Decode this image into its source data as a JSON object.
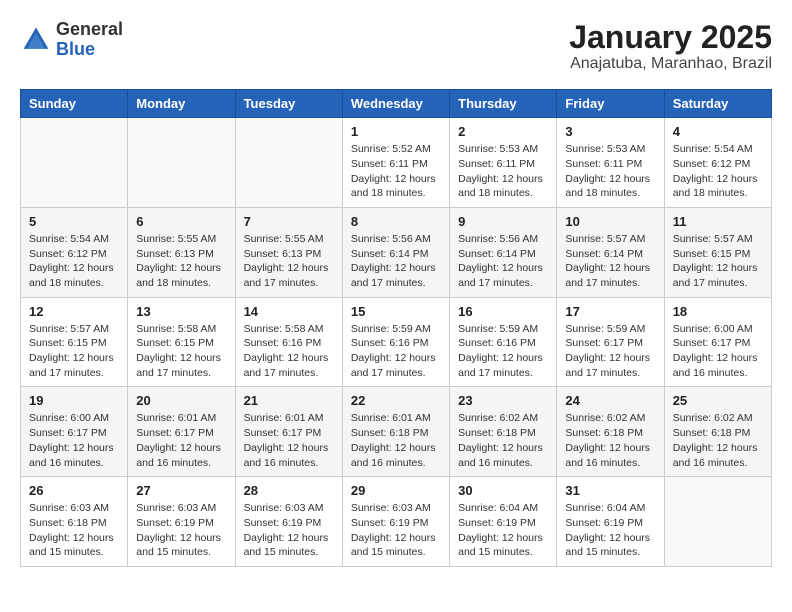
{
  "header": {
    "logo_general": "General",
    "logo_blue": "Blue",
    "title": "January 2025",
    "subtitle": "Anajatuba, Maranhao, Brazil"
  },
  "days_of_week": [
    "Sunday",
    "Monday",
    "Tuesday",
    "Wednesday",
    "Thursday",
    "Friday",
    "Saturday"
  ],
  "weeks": [
    [
      {
        "day": "",
        "info": ""
      },
      {
        "day": "",
        "info": ""
      },
      {
        "day": "",
        "info": ""
      },
      {
        "day": "1",
        "info": "Sunrise: 5:52 AM\nSunset: 6:11 PM\nDaylight: 12 hours\nand 18 minutes."
      },
      {
        "day": "2",
        "info": "Sunrise: 5:53 AM\nSunset: 6:11 PM\nDaylight: 12 hours\nand 18 minutes."
      },
      {
        "day": "3",
        "info": "Sunrise: 5:53 AM\nSunset: 6:11 PM\nDaylight: 12 hours\nand 18 minutes."
      },
      {
        "day": "4",
        "info": "Sunrise: 5:54 AM\nSunset: 6:12 PM\nDaylight: 12 hours\nand 18 minutes."
      }
    ],
    [
      {
        "day": "5",
        "info": "Sunrise: 5:54 AM\nSunset: 6:12 PM\nDaylight: 12 hours\nand 18 minutes."
      },
      {
        "day": "6",
        "info": "Sunrise: 5:55 AM\nSunset: 6:13 PM\nDaylight: 12 hours\nand 18 minutes."
      },
      {
        "day": "7",
        "info": "Sunrise: 5:55 AM\nSunset: 6:13 PM\nDaylight: 12 hours\nand 17 minutes."
      },
      {
        "day": "8",
        "info": "Sunrise: 5:56 AM\nSunset: 6:14 PM\nDaylight: 12 hours\nand 17 minutes."
      },
      {
        "day": "9",
        "info": "Sunrise: 5:56 AM\nSunset: 6:14 PM\nDaylight: 12 hours\nand 17 minutes."
      },
      {
        "day": "10",
        "info": "Sunrise: 5:57 AM\nSunset: 6:14 PM\nDaylight: 12 hours\nand 17 minutes."
      },
      {
        "day": "11",
        "info": "Sunrise: 5:57 AM\nSunset: 6:15 PM\nDaylight: 12 hours\nand 17 minutes."
      }
    ],
    [
      {
        "day": "12",
        "info": "Sunrise: 5:57 AM\nSunset: 6:15 PM\nDaylight: 12 hours\nand 17 minutes."
      },
      {
        "day": "13",
        "info": "Sunrise: 5:58 AM\nSunset: 6:15 PM\nDaylight: 12 hours\nand 17 minutes."
      },
      {
        "day": "14",
        "info": "Sunrise: 5:58 AM\nSunset: 6:16 PM\nDaylight: 12 hours\nand 17 minutes."
      },
      {
        "day": "15",
        "info": "Sunrise: 5:59 AM\nSunset: 6:16 PM\nDaylight: 12 hours\nand 17 minutes."
      },
      {
        "day": "16",
        "info": "Sunrise: 5:59 AM\nSunset: 6:16 PM\nDaylight: 12 hours\nand 17 minutes."
      },
      {
        "day": "17",
        "info": "Sunrise: 5:59 AM\nSunset: 6:17 PM\nDaylight: 12 hours\nand 17 minutes."
      },
      {
        "day": "18",
        "info": "Sunrise: 6:00 AM\nSunset: 6:17 PM\nDaylight: 12 hours\nand 16 minutes."
      }
    ],
    [
      {
        "day": "19",
        "info": "Sunrise: 6:00 AM\nSunset: 6:17 PM\nDaylight: 12 hours\nand 16 minutes."
      },
      {
        "day": "20",
        "info": "Sunrise: 6:01 AM\nSunset: 6:17 PM\nDaylight: 12 hours\nand 16 minutes."
      },
      {
        "day": "21",
        "info": "Sunrise: 6:01 AM\nSunset: 6:17 PM\nDaylight: 12 hours\nand 16 minutes."
      },
      {
        "day": "22",
        "info": "Sunrise: 6:01 AM\nSunset: 6:18 PM\nDaylight: 12 hours\nand 16 minutes."
      },
      {
        "day": "23",
        "info": "Sunrise: 6:02 AM\nSunset: 6:18 PM\nDaylight: 12 hours\nand 16 minutes."
      },
      {
        "day": "24",
        "info": "Sunrise: 6:02 AM\nSunset: 6:18 PM\nDaylight: 12 hours\nand 16 minutes."
      },
      {
        "day": "25",
        "info": "Sunrise: 6:02 AM\nSunset: 6:18 PM\nDaylight: 12 hours\nand 16 minutes."
      }
    ],
    [
      {
        "day": "26",
        "info": "Sunrise: 6:03 AM\nSunset: 6:18 PM\nDaylight: 12 hours\nand 15 minutes."
      },
      {
        "day": "27",
        "info": "Sunrise: 6:03 AM\nSunset: 6:19 PM\nDaylight: 12 hours\nand 15 minutes."
      },
      {
        "day": "28",
        "info": "Sunrise: 6:03 AM\nSunset: 6:19 PM\nDaylight: 12 hours\nand 15 minutes."
      },
      {
        "day": "29",
        "info": "Sunrise: 6:03 AM\nSunset: 6:19 PM\nDaylight: 12 hours\nand 15 minutes."
      },
      {
        "day": "30",
        "info": "Sunrise: 6:04 AM\nSunset: 6:19 PM\nDaylight: 12 hours\nand 15 minutes."
      },
      {
        "day": "31",
        "info": "Sunrise: 6:04 AM\nSunset: 6:19 PM\nDaylight: 12 hours\nand 15 minutes."
      },
      {
        "day": "",
        "info": ""
      }
    ]
  ]
}
